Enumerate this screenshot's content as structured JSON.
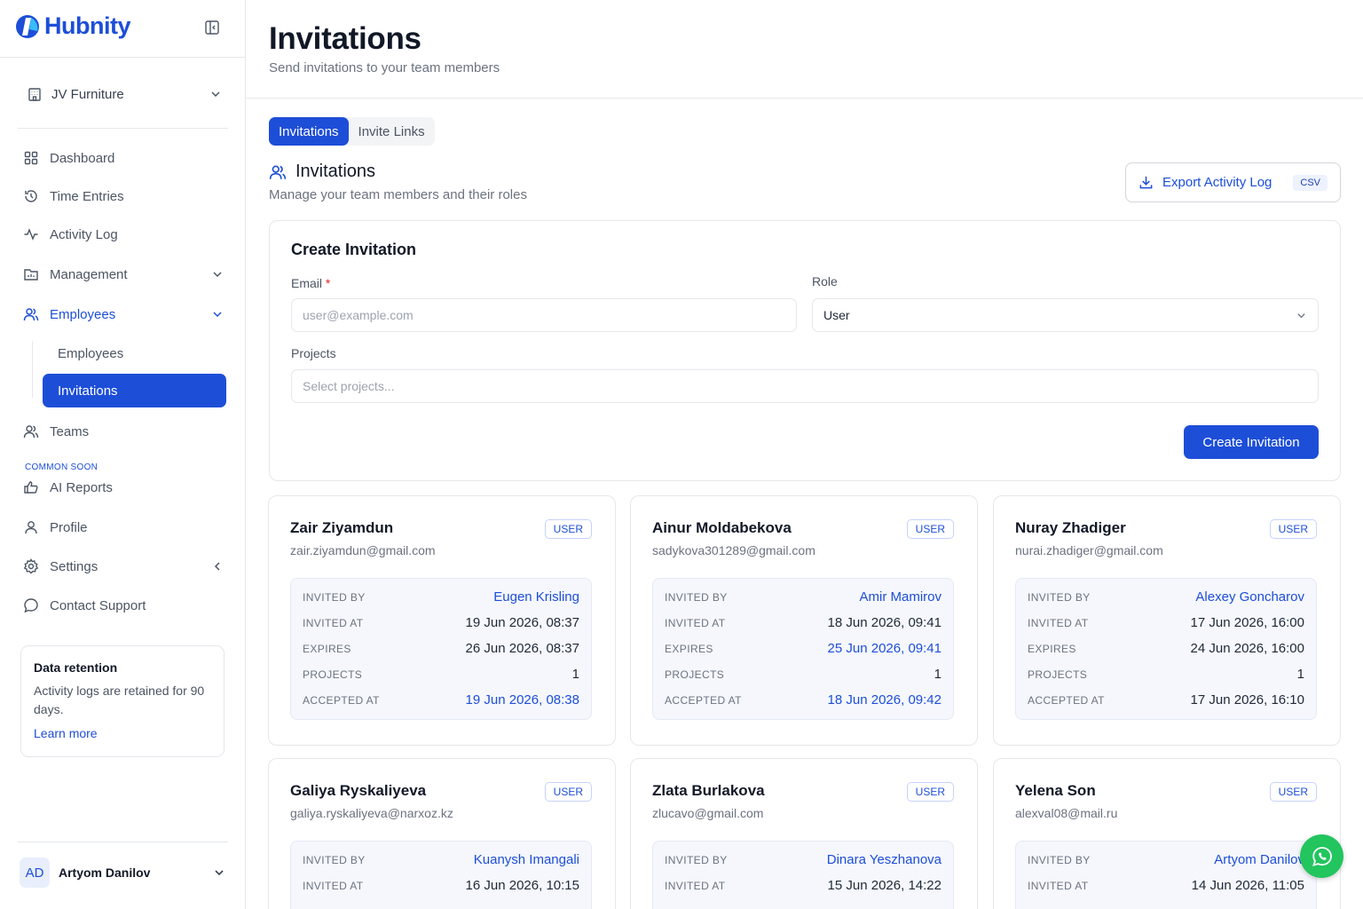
{
  "brand": {
    "name": "Hubnity",
    "color": "#1d4ed8"
  },
  "org": {
    "name": "JV Furniture"
  },
  "nav": {
    "dashboard": "Dashboard",
    "time_entries": "Time Entries",
    "activity_log": "Activity Log",
    "management": "Management",
    "employees": "Employees",
    "employees_sub": "Employees",
    "invitations_sub": "Invitations",
    "teams": "Teams",
    "soon_tag": "COMMON SOON",
    "ai_reports": "AI Reports",
    "profile": "Profile",
    "settings": "Settings",
    "contact_support": "Contact Support"
  },
  "retention": {
    "title": "Data retention",
    "text": "Activity logs are retained for 90 days.",
    "link": "Learn more"
  },
  "user": {
    "initials": "AD",
    "name": "Artyom Danilov"
  },
  "page": {
    "title": "Invitations",
    "subtitle": "Send invitations to your team members"
  },
  "tabs": [
    {
      "label": "Invitations",
      "active": true
    },
    {
      "label": "Invite Links",
      "active": false
    }
  ],
  "section": {
    "title": "Invitations",
    "subtitle": "Manage your team members and their roles",
    "export_label": "Export Activity Log",
    "export_tag": "CSV"
  },
  "create_form": {
    "title": "Create Invitation",
    "email_label": "Email",
    "email_required": "*",
    "email_placeholder": "user@example.com",
    "role_label": "Role",
    "role_value": "User",
    "projects_label": "Projects",
    "projects_placeholder": "Select projects...",
    "submit_label": "Create Invitation"
  },
  "invitations": [
    {
      "name": "Zair Ziyamdun",
      "email": "zair.ziyamdun@gmail.com",
      "role": "USER",
      "rows": [
        {
          "key": "INVITED BY",
          "value": "Eugen Krisling",
          "blue": true
        },
        {
          "key": "INVITED AT",
          "value": "19 Jun 2026, 08:37",
          "blue": false
        },
        {
          "key": "EXPIRES",
          "value": "26 Jun 2026, 08:37",
          "blue": false
        },
        {
          "key": "PROJECTS",
          "value": "1",
          "blue": false
        },
        {
          "key": "ACCEPTED AT",
          "value": "19 Jun 2026, 08:38",
          "blue": true
        }
      ]
    },
    {
      "name": "Ainur Moldabekova",
      "email": "sadykova301289@gmail.com",
      "role": "USER",
      "rows": [
        {
          "key": "INVITED BY",
          "value": "Amir Mamirov",
          "blue": true
        },
        {
          "key": "INVITED AT",
          "value": "18 Jun 2026, 09:41",
          "blue": false
        },
        {
          "key": "EXPIRES",
          "value": "25 Jun 2026, 09:41",
          "blue": true
        },
        {
          "key": "PROJECTS",
          "value": "1",
          "blue": false
        },
        {
          "key": "ACCEPTED AT",
          "value": "18 Jun 2026, 09:42",
          "blue": true
        }
      ]
    },
    {
      "name": "Nuray Zhadiger",
      "email": "nurai.zhadiger@gmail.com",
      "role": "USER",
      "rows": [
        {
          "key": "INVITED BY",
          "value": "Alexey Goncharov",
          "blue": true
        },
        {
          "key": "INVITED AT",
          "value": "17 Jun 2026, 16:00",
          "blue": false
        },
        {
          "key": "EXPIRES",
          "value": "24 Jun 2026, 16:00",
          "blue": false
        },
        {
          "key": "PROJECTS",
          "value": "1",
          "blue": false
        },
        {
          "key": "ACCEPTED AT",
          "value": "17 Jun 2026, 16:10",
          "blue": false
        }
      ]
    },
    {
      "name": "Galiya Ryskaliyeva",
      "email": "galiya.ryskaliyeva@narxoz.kz",
      "role": "USER",
      "rows": [
        {
          "key": "INVITED BY",
          "value": "Kuanysh Imangali",
          "blue": true
        },
        {
          "key": "INVITED AT",
          "value": "16 Jun 2026, 10:15",
          "blue": false
        }
      ]
    },
    {
      "name": "Zlata Burlakova",
      "email": "zlucavo@gmail.com",
      "role": "USER",
      "rows": [
        {
          "key": "INVITED BY",
          "value": "Dinara Yeszhanova",
          "blue": true
        },
        {
          "key": "INVITED AT",
          "value": "15 Jun 2026, 14:22",
          "blue": false
        }
      ]
    },
    {
      "name": "Yelena Son",
      "email": "alexval08@mail.ru",
      "role": "USER",
      "rows": [
        {
          "key": "INVITED BY",
          "value": "Artyom Danilov",
          "blue": true
        },
        {
          "key": "INVITED AT",
          "value": "14 Jun 2026, 11:05",
          "blue": false
        }
      ]
    }
  ]
}
